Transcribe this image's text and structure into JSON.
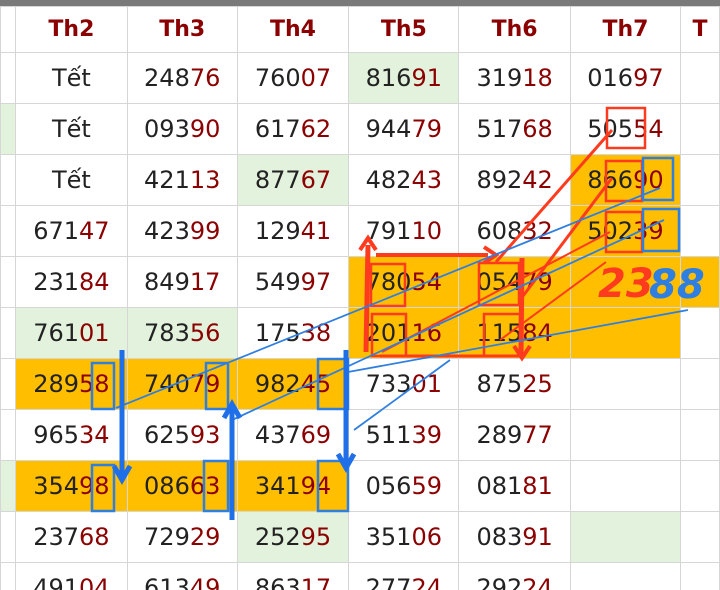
{
  "headers": [
    "Th2",
    "Th3",
    "Th4",
    "Th5",
    "Th6",
    "Th7",
    "T"
  ],
  "rows": [
    {
      "cells": [
        {
          "h": "Tết",
          "t": ""
        },
        {
          "h": "248",
          "t": "76"
        },
        {
          "h": "760",
          "t": "07"
        },
        {
          "h": "816",
          "t": "91"
        },
        {
          "h": "319",
          "t": "18"
        },
        {
          "h": "016",
          "t": "97"
        }
      ]
    },
    {
      "cells": [
        {
          "h": "Tết",
          "t": ""
        },
        {
          "h": "093",
          "t": "90"
        },
        {
          "h": "617",
          "t": "62"
        },
        {
          "h": "944",
          "t": "79"
        },
        {
          "h": "517",
          "t": "68"
        },
        {
          "h": "505",
          "t": "54"
        }
      ]
    },
    {
      "cells": [
        {
          "h": "Tết",
          "t": ""
        },
        {
          "h": "421",
          "t": "13"
        },
        {
          "h": "877",
          "t": "67"
        },
        {
          "h": "482",
          "t": "43"
        },
        {
          "h": "892",
          "t": "42"
        },
        {
          "h": "866",
          "t": "90"
        }
      ]
    },
    {
      "cells": [
        {
          "h": "671",
          "t": "47"
        },
        {
          "h": "423",
          "t": "99"
        },
        {
          "h": "129",
          "t": "41"
        },
        {
          "h": "791",
          "t": "10"
        },
        {
          "h": "608",
          "t": "32"
        },
        {
          "h": "502",
          "t": "39"
        }
      ]
    },
    {
      "cells": [
        {
          "h": "231",
          "t": "84"
        },
        {
          "h": "849",
          "t": "17"
        },
        {
          "h": "549",
          "t": "97"
        },
        {
          "h": "780",
          "t": "54"
        },
        {
          "h": "054",
          "t": "79"
        },
        {
          "h": "",
          "t": ""
        }
      ]
    },
    {
      "cells": [
        {
          "h": "761",
          "t": "01"
        },
        {
          "h": "783",
          "t": "56"
        },
        {
          "h": "175",
          "t": "38"
        },
        {
          "h": "201",
          "t": "16"
        },
        {
          "h": "115",
          "t": "84"
        },
        {
          "h": "",
          "t": ""
        }
      ]
    },
    {
      "cells": [
        {
          "h": "289",
          "t": "58"
        },
        {
          "h": "740",
          "t": "79"
        },
        {
          "h": "982",
          "t": "45"
        },
        {
          "h": "733",
          "t": "01"
        },
        {
          "h": "875",
          "t": "25"
        },
        {
          "h": "",
          "t": ""
        }
      ]
    },
    {
      "cells": [
        {
          "h": "965",
          "t": "34"
        },
        {
          "h": "625",
          "t": "93"
        },
        {
          "h": "437",
          "t": "69"
        },
        {
          "h": "511",
          "t": "39"
        },
        {
          "h": "289",
          "t": "77"
        },
        {
          "h": "",
          "t": ""
        }
      ]
    },
    {
      "cells": [
        {
          "h": "354",
          "t": "98"
        },
        {
          "h": "086",
          "t": "63"
        },
        {
          "h": "341",
          "t": "94"
        },
        {
          "h": "056",
          "t": "59"
        },
        {
          "h": "081",
          "t": "81"
        },
        {
          "h": "",
          "t": ""
        }
      ]
    },
    {
      "cells": [
        {
          "h": "237",
          "t": "68"
        },
        {
          "h": "729",
          "t": "29"
        },
        {
          "h": "252",
          "t": "95"
        },
        {
          "h": "351",
          "t": "06"
        },
        {
          "h": "083",
          "t": "91"
        },
        {
          "h": "",
          "t": ""
        }
      ]
    },
    {
      "cells": [
        {
          "h": "491",
          "t": "04"
        },
        {
          "h": "613",
          "t": "49"
        },
        {
          "h": "863",
          "t": "17"
        },
        {
          "h": "277",
          "t": "24"
        },
        {
          "h": "292",
          "t": "24"
        },
        {
          "h": "",
          "t": ""
        }
      ]
    }
  ],
  "annotation": {
    "red_part": "23",
    "blue_part": "88"
  },
  "colors": {
    "header_text": "#8b0000",
    "tail_text": "#8b0000",
    "highlight_orange": "#ffbe00",
    "highlight_green": "#e2f2dd",
    "pen_red": "#ff3b1f",
    "pen_blue": "#2f7fe0",
    "bold_blue": "#1e6fe8"
  }
}
